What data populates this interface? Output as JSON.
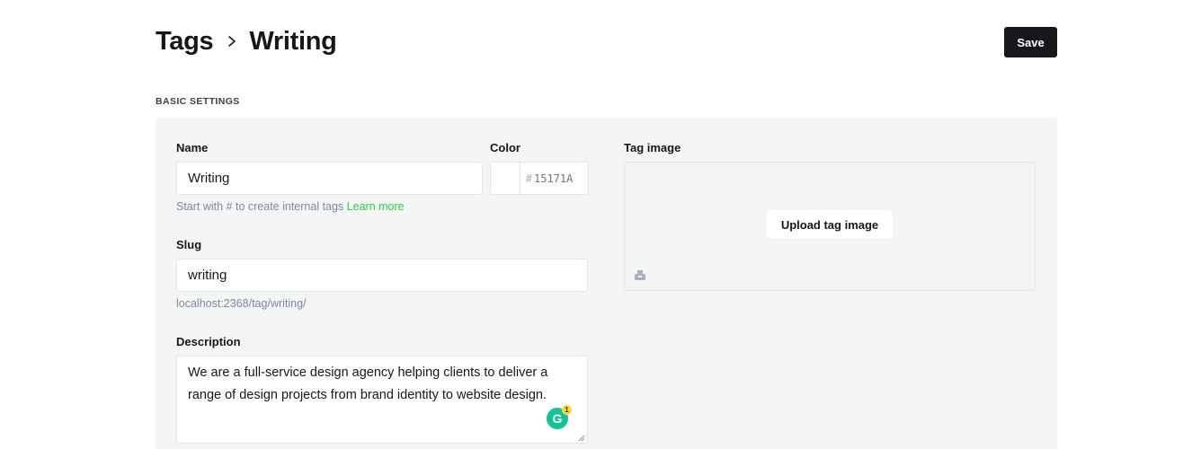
{
  "header": {
    "breadcrumb_parent": "Tags",
    "breadcrumb_current": "Writing",
    "save_label": "Save"
  },
  "section_title": "BASIC SETTINGS",
  "form": {
    "name": {
      "label": "Name",
      "value": "Writing",
      "hint": "Start with # to create internal tags",
      "hint_link": "Learn more"
    },
    "color": {
      "label": "Color",
      "hash": "#",
      "value": "",
      "placeholder": "15171A"
    },
    "slug": {
      "label": "Slug",
      "value": "writing",
      "url": "localhost:2368/tag/writing/"
    },
    "description": {
      "label": "Description",
      "value": "We are a full-service design agency helping clients to deliver a range of design projects from brand identity to website design."
    },
    "tag_image": {
      "label": "Tag image",
      "upload_label": "Upload tag image"
    }
  },
  "grammarly": {
    "letter": "G",
    "badge_count": "1"
  },
  "colors": {
    "text": "#15171a",
    "card_bg": "#f4f5f5",
    "link_green": "#30cf43",
    "hint_gray": "#7c8b9a",
    "save_bg": "#15171a",
    "grammarly": "#15c39a"
  }
}
